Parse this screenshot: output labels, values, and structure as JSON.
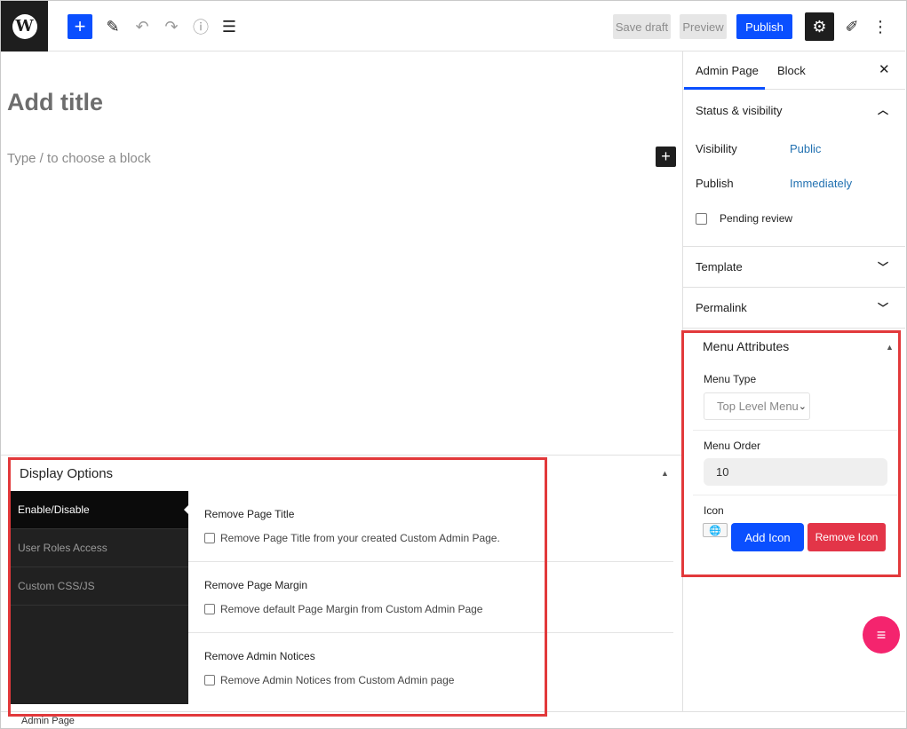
{
  "topbar": {
    "add_block": "+",
    "save_draft": "Save draft",
    "preview": "Preview",
    "publish": "Publish"
  },
  "editor": {
    "title_placeholder": "Add title",
    "block_placeholder": "Type / to choose a block"
  },
  "display_options": {
    "title": "Display Options",
    "tabs": [
      "Enable/Disable",
      "User Roles Access",
      "Custom CSS/JS"
    ],
    "options": [
      {
        "title": "Remove Page Title",
        "label": "Remove Page Title from your created Custom Admin Page."
      },
      {
        "title": "Remove Page Margin",
        "label": "Remove default Page Margin from Custom Admin Page"
      },
      {
        "title": "Remove Admin Notices",
        "label": "Remove Admin Notices from Custom Admin page"
      }
    ]
  },
  "sidebar": {
    "tabs": [
      "Admin Page",
      "Block"
    ],
    "status_visibility": {
      "title": "Status & visibility",
      "visibility_label": "Visibility",
      "visibility_value": "Public",
      "publish_label": "Publish",
      "publish_value": "Immediately",
      "pending_review": "Pending review"
    },
    "template": "Template",
    "permalink": "Permalink",
    "menu_attributes": {
      "title": "Menu Attributes",
      "menu_type_label": "Menu Type",
      "menu_type_value": "Top Level Menu",
      "menu_order_label": "Menu Order",
      "menu_order_value": "10",
      "icon_label": "Icon",
      "add_icon": "Add Icon",
      "remove_icon": "Remove Icon"
    }
  },
  "footer": {
    "breadcrumb": "Admin Page"
  },
  "colors": {
    "accent": "#0a4fff",
    "danger": "#e33548",
    "highlight": "#e2393b",
    "fab": "#f4246e"
  }
}
